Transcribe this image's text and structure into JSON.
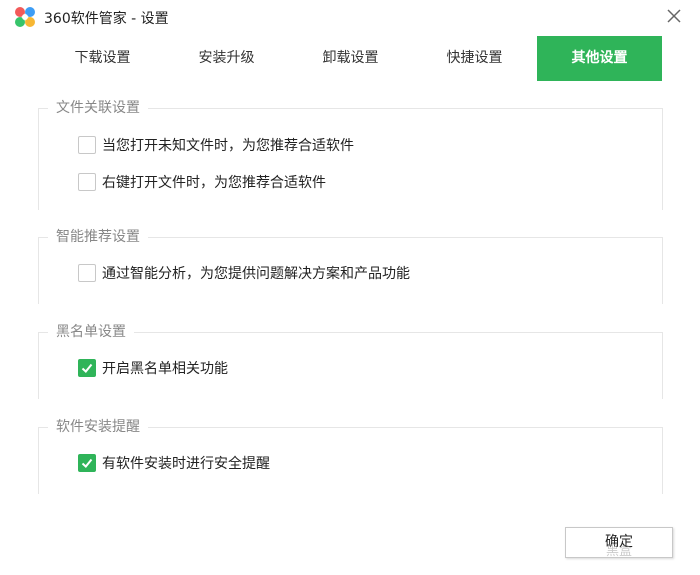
{
  "window": {
    "title": "360软件管家 - 设置",
    "accent_color": "#2fb459",
    "logo_icon": "360-software-manager-logo",
    "close_icon": "close-icon"
  },
  "tabs": [
    {
      "label": "下载设置",
      "active": false
    },
    {
      "label": "安装升级",
      "active": false
    },
    {
      "label": "卸载设置",
      "active": false
    },
    {
      "label": "快捷设置",
      "active": false
    },
    {
      "label": "其他设置",
      "active": true
    }
  ],
  "groups": [
    {
      "title": "文件关联设置",
      "options": [
        {
          "label": "当您打开未知文件时，为您推荐合适软件",
          "checked": false
        },
        {
          "label": "右键打开文件时，为您推荐合适软件",
          "checked": false
        }
      ]
    },
    {
      "title": "智能推荐设置",
      "options": [
        {
          "label": "通过智能分析，为您提供问题解决方案和产品功能",
          "checked": false
        }
      ]
    },
    {
      "title": "黑名单设置",
      "options": [
        {
          "label": "开启黑名单相关功能",
          "checked": true
        }
      ]
    },
    {
      "title": "软件安装提醒",
      "options": [
        {
          "label": "有软件安装时进行安全提醒",
          "checked": true
        }
      ]
    }
  ],
  "footer": {
    "ok_label": "确定",
    "watermark": "黑盒"
  }
}
